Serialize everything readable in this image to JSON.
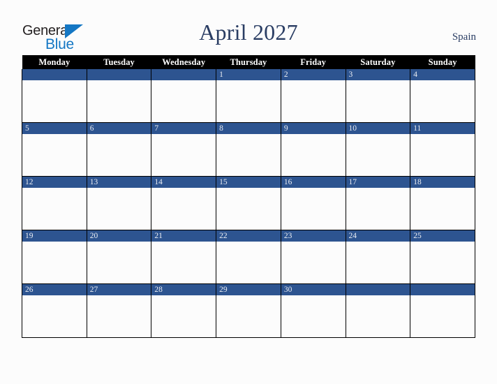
{
  "brand": {
    "word_one": "General",
    "word_two": "Blue",
    "triangle_icon": "triangle-icon",
    "color_dark": "#231f20",
    "color_blue": "#1477c4"
  },
  "header": {
    "title": "April 2027",
    "region": "Spain",
    "title_color": "#2a3d63"
  },
  "calendar": {
    "weekday_headers": [
      "Monday",
      "Tuesday",
      "Wednesday",
      "Thursday",
      "Friday",
      "Saturday",
      "Sunday"
    ],
    "header_bg": "#000000",
    "header_fg": "#ffffff",
    "daybar_bg": "#2d5490",
    "daybar_fg": "#e9ecf2",
    "cell_bg": "#fcfcfc",
    "grid_line": "#000000",
    "weeks": [
      [
        "",
        "",
        "",
        "1",
        "2",
        "3",
        "4"
      ],
      [
        "5",
        "6",
        "7",
        "8",
        "9",
        "10",
        "11"
      ],
      [
        "12",
        "13",
        "14",
        "15",
        "16",
        "17",
        "18"
      ],
      [
        "19",
        "20",
        "21",
        "22",
        "23",
        "24",
        "25"
      ],
      [
        "26",
        "27",
        "28",
        "29",
        "30",
        "",
        ""
      ]
    ]
  }
}
